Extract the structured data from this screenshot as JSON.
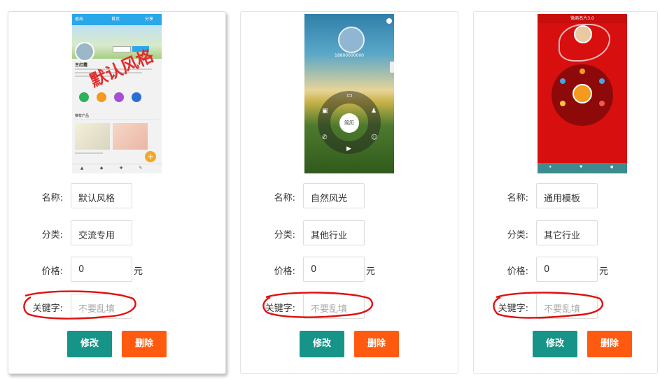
{
  "field_labels": {
    "name": "名称:",
    "category": "分类:",
    "price": "价格:",
    "keywords": "关键字:"
  },
  "price_unit": "元",
  "buttons": {
    "edit": "修改",
    "delete": "删除"
  },
  "colors": {
    "edit": "#169488",
    "delete": "#ff5a0f",
    "annotation": "#e01010"
  },
  "cards": [
    {
      "name": "默认风格",
      "category": "交流专用",
      "price": "0",
      "keywords_placeholder": "不要乱填",
      "thumbnail": {
        "stamp": "默认风格",
        "phone_top_left": "退出",
        "phone_top_center": "首页",
        "phone_top_right": "分享",
        "user_name": "王红霞",
        "section": "推荐产品"
      }
    },
    {
      "name": "自然风光",
      "category": "其他行业",
      "price": "0",
      "keywords_placeholder": "不要乱填",
      "thumbnail": {
        "phone_number": "18800000000",
        "center_label": "简历"
      }
    },
    {
      "name": "通用模板",
      "category": "其它行业",
      "price": "0",
      "keywords_placeholder": "不要乱填",
      "thumbnail": {
        "title": "微商名片3.0"
      }
    }
  ]
}
